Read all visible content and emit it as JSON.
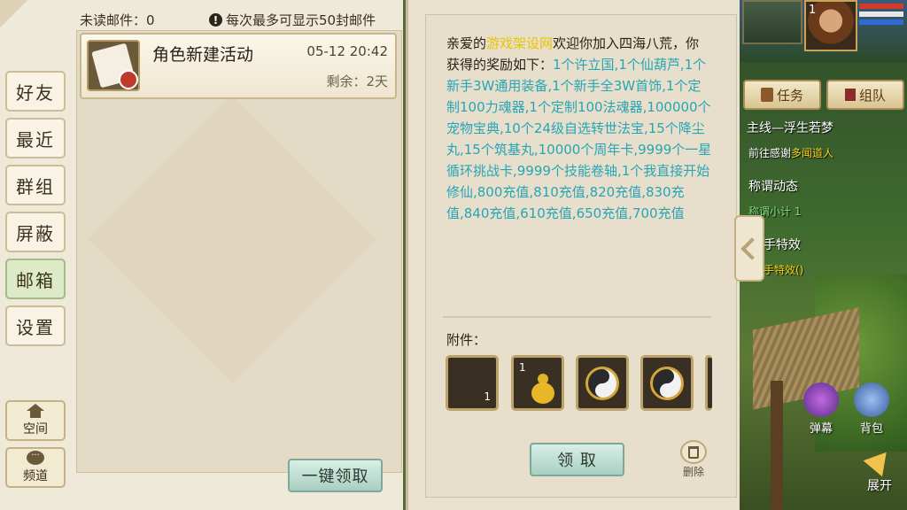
{
  "left": {
    "unread_label": "未读邮件：",
    "unread_count": "0",
    "limit_notice": "每次最多可显示50封邮件",
    "nav": [
      "好友",
      "最近",
      "群组",
      "屏蔽",
      "邮箱",
      "设置"
    ],
    "active_nav": "邮箱",
    "bottom": [
      {
        "label": "空间",
        "icon": "home-icon"
      },
      {
        "label": "频道",
        "icon": "chat-bubble-icon"
      }
    ],
    "claim_all_button": "一键领取"
  },
  "mail": {
    "title": "角色新建活动",
    "date": "05-12 20:42",
    "remaining": "剩余：2天",
    "thumb_icon": "letter-icon"
  },
  "detail": {
    "greeting_prefix": "亲爱的",
    "site": "游戏架设网",
    "greeting_suffix": "欢迎你加入四海八荒，你获得的奖励如下：",
    "rewards": "1个许立国,1个仙葫芦,1个新手3W通用装备,1个新手全3W首饰,1个定制100力魂器,1个定制100法魂器,100000个宠物宝典,10个24级自选转世法宝,15个降尘丸,15个筑基丸,10000个周年卡,9999个一星循环挑战卡,9999个技能卷轴,1个我直接开始修仙,800充值,810充值,820充值,830充值,840充值,610充值,650充值,700充值",
    "attachments_label": "附件：",
    "slots": [
      {
        "count": "1",
        "icon": "empty-item-icon"
      },
      {
        "count": "1",
        "icon": "gourd-icon"
      },
      {
        "count": "",
        "icon": "yin-yang-icon"
      },
      {
        "count": "",
        "icon": "yin-yang-icon"
      }
    ],
    "claim_button": "领 取",
    "delete_label": "删除"
  },
  "hud": {
    "level": "1",
    "task_button": "任务",
    "team_button": "组队",
    "quests": [
      {
        "text": "主线—浮生若梦"
      },
      {
        "text": "前往感谢",
        "highlight": "多闻道人"
      },
      {
        "text": "称谓动态"
      },
      {
        "text": "称谓小计 1"
      },
      {
        "text": "手特效"
      },
      {
        "text": "手特效()"
      }
    ],
    "barrage_label": "弹幕",
    "bag_label": "背包",
    "expand_label": "展开",
    "colors": {
      "hp": "#d23b2b",
      "mp": "#2f6bd2",
      "exp": "#e7e7e7"
    }
  }
}
